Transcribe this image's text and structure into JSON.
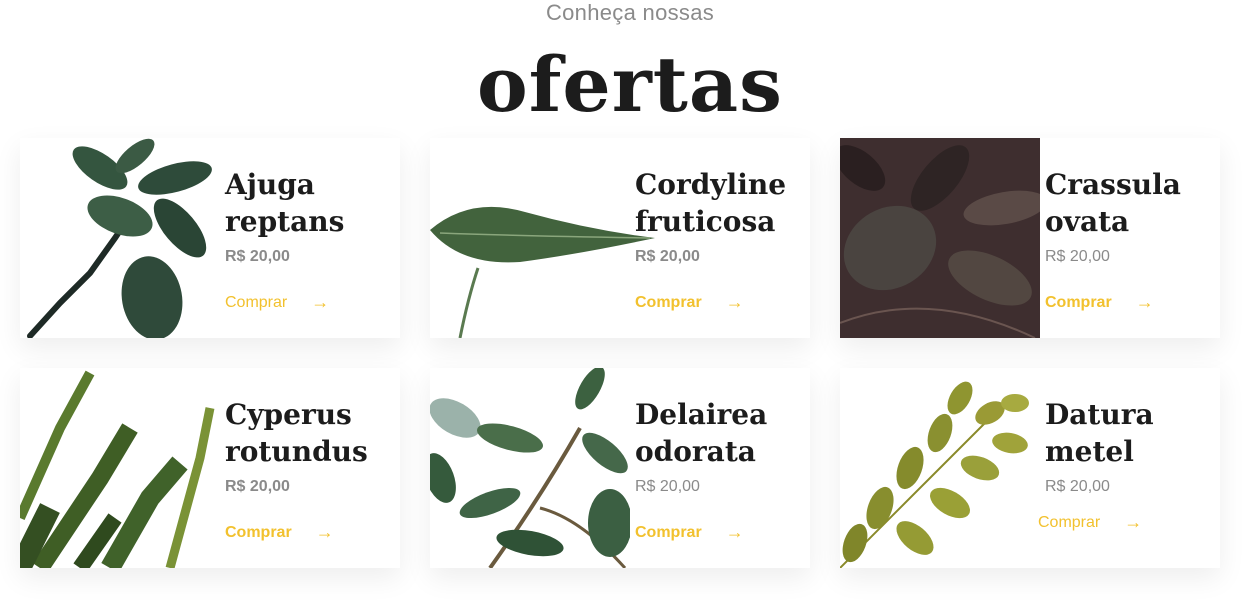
{
  "header": {
    "eyebrow": "Conheça nossas",
    "title": "ofertas"
  },
  "colors": {
    "accent": "#f2c12e",
    "text_dark": "#1c1c1c",
    "text_muted": "#8a8a8a"
  },
  "products": [
    {
      "name": "Ajuga\nreptans",
      "price": "R$ 20,00",
      "buy_label": "Comprar",
      "arrow": "→"
    },
    {
      "name": "Cordyline\nfruticosa",
      "price": "R$ 20,00",
      "buy_label": "Comprar",
      "arrow": "→"
    },
    {
      "name": "Crassula\novata",
      "price": "R$ 20,00",
      "buy_label": "Comprar",
      "arrow": "→"
    },
    {
      "name": "Cyperus\nrotundus",
      "price": "R$ 20,00",
      "buy_label": "Comprar",
      "arrow": "→"
    },
    {
      "name": "Delairea\nodorata",
      "price": "R$ 20,00",
      "buy_label": "Comprar",
      "arrow": "→"
    },
    {
      "name": "Datura\nmetel",
      "price": "R$ 20,00",
      "buy_label": "Comprar",
      "arrow": "→"
    }
  ]
}
